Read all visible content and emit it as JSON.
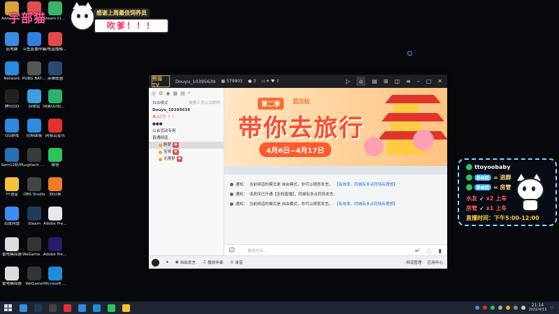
{
  "overlay_top": {
    "streamer_name": "宇部猫",
    "banner_thanks": "感谢上周最佳饲养员",
    "banner_bubble": "吹爹！！！"
  },
  "desktop_icons": [
    {
      "label": "Administ...",
      "icon": "user-folder-icon",
      "color": "#d9a33b"
    },
    {
      "label": "小飞鼠",
      "icon": "app-icon",
      "color": "#e05050"
    },
    {
      "label": "Steam Cleaner",
      "icon": "steam-cleaner-icon",
      "color": "#3ab36b"
    },
    {
      "label": "此电脑",
      "icon": "computer-icon",
      "color": "#3c8be0"
    },
    {
      "label": "斗鱼直播伴侣",
      "icon": "music-note-icon",
      "color": "#2f7fe0"
    },
    {
      "label": "闪电直播模式转换器",
      "icon": "pinwheel-icon",
      "color": "#e24a4a"
    },
    {
      "label": "Network",
      "icon": "network-globe-icon",
      "color": "#2b8ae0"
    },
    {
      "label": "PUBG BATTLEGR...",
      "icon": "pubg-icon",
      "color": "#555555"
    },
    {
      "label": "英雄联盟",
      "icon": "lol-icon",
      "color": "#2a4a70"
    },
    {
      "label": "腾讯QQ",
      "icon": "qq-icon",
      "color": "#202020"
    },
    {
      "label": "回收站",
      "icon": "recycle-bin-icon",
      "color": "#3ca0e0"
    },
    {
      "label": "网易UU加速器",
      "icon": "uu-accelerator-icon",
      "color": "#28b46a"
    },
    {
      "label": "QQ游戏",
      "icon": "qq-game-icon",
      "color": "#2a8be0"
    },
    {
      "label": "控制面板",
      "icon": "control-panel-icon",
      "color": "#2d8de0"
    },
    {
      "label": "网易云音乐",
      "icon": "netease-music-icon",
      "color": "#e03232"
    },
    {
      "label": "Sam12机早",
      "icon": "steam-icon",
      "color": "#2a6fb0"
    },
    {
      "label": "Logitech G HUB",
      "icon": "logitech-icon",
      "color": "#3a3a3a"
    },
    {
      "label": "微信",
      "icon": "wechat-icon",
      "color": "#2bc45d"
    },
    {
      "label": "YY语音",
      "icon": "yy-icon",
      "color": "#f5c23a"
    },
    {
      "label": "OBS Studio",
      "icon": "obs-icon",
      "color": "#444444"
    },
    {
      "label": "向日葵",
      "icon": "sunflower-icon",
      "color": "#f07a28"
    },
    {
      "label": "百度网盘",
      "icon": "baidu-netdisk-icon",
      "color": "#3a8ef0"
    },
    {
      "label": "Steam",
      "icon": "steam-icon",
      "color": "#203a5a"
    },
    {
      "label": "Adobe Premie...",
      "icon": "adobe-icon",
      "color": "#e8e8e8"
    },
    {
      "label": "雷电模拟器",
      "icon": "file-icon",
      "color": "#dddddd"
    },
    {
      "label": "WeGame (2)",
      "icon": "wegame-icon",
      "color": "#333333"
    },
    {
      "label": "Adobe Premie...",
      "icon": "premiere-icon",
      "color": "#2a1a6a"
    },
    {
      "label": "雷电模拟器",
      "icon": "file-icon",
      "color": "#dddddd"
    },
    {
      "label": "WeGame",
      "icon": "wegame-icon",
      "color": "#333333"
    },
    {
      "label": "Microsoft Edge",
      "icon": "edge-icon",
      "color": "#1e8cd8"
    },
    {
      "label": "虎牙直播",
      "icon": "huya-icon",
      "color": "#f5a623"
    }
  ],
  "window": {
    "logo": "熊猫TV",
    "channel": "Douyu_10395639",
    "viewers": "579903",
    "members": "3",
    "sidebar": {
      "header": "自由模式",
      "search": "搜索人员以及昵称",
      "channel_name": "Douyu_10395639",
      "highlight": "未入门！！！",
      "lines": [
        "●●●",
        "公会活动专用",
        "普通频道"
      ],
      "members": [
        {
          "name": "胖梦",
          "selected": true
        },
        {
          "name": "宝哥",
          "selected": false
        },
        {
          "name": "无限梦",
          "selected": false
        }
      ]
    },
    "banner": {
      "season": "第二季",
      "city": "武汉站",
      "title": "带你去旅行",
      "dates": "4月6日~4月17日"
    },
    "chat_notices": [
      {
        "prefix": "通知：",
        "text": "当前频道的模式是 自由模式，你可以随意发言。",
        "link": "【有效率、同城有多点同场有理想】"
      },
      {
        "prefix": "通知：",
        "text": "该房间已开通【全网直播】，同城有多点同场发言。",
        "link": ""
      },
      {
        "prefix": "通知：",
        "text": "当前频道的模式是 自由模式，你可以随意发言。",
        "link": "【有效率、同城有多点同场有理想】"
      }
    ],
    "input_placeholder": "说点什么...",
    "bottombar": {
      "item1": "自由发言",
      "item2": "播放伴奏",
      "item3": "录音",
      "right1": "频道管理",
      "right2": "应用中心"
    }
  },
  "overlay_right": {
    "wechat_id": "ttoyoobaby",
    "row1_tag": "粉丝团",
    "row1_text": "= 进群",
    "row2_tag": "粉丝团",
    "row2_text": "= 房管",
    "row3_label": "水友",
    "row3_text": "x2 上车",
    "row4_label": "房管",
    "row4_text": "x1 上车",
    "schedule": "直播时间：下午5:00-12:00"
  },
  "taskbar": {
    "time": "21:14",
    "date": "2022/4/13"
  }
}
